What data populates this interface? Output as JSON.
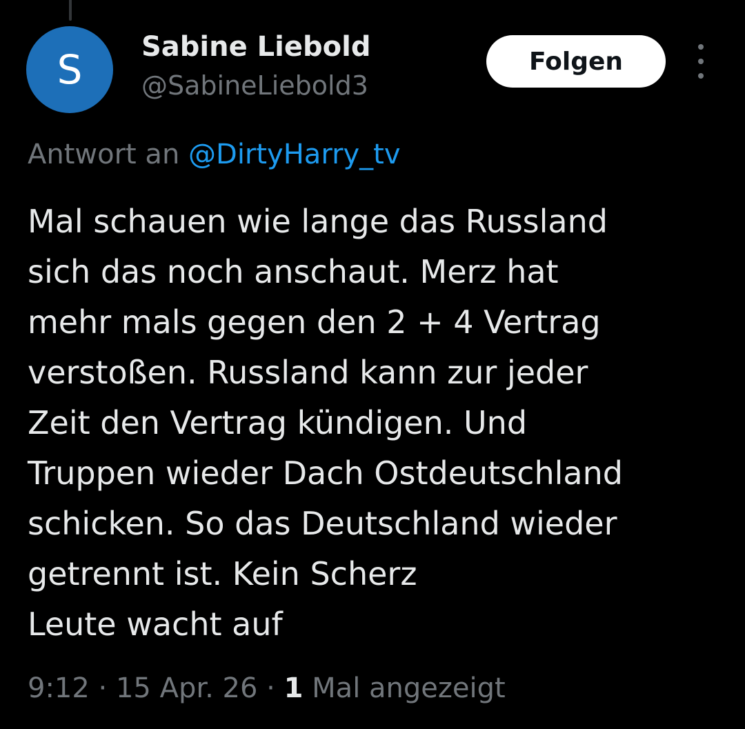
{
  "author": {
    "avatar_letter": "S",
    "avatar_color": "#1d6fb8",
    "display_name": "Sabine Liebold",
    "handle": "@SabineLiebold3"
  },
  "actions": {
    "follow_label": "Folgen",
    "more_icon": "more-vertical-icon"
  },
  "reply": {
    "prefix": "Antwort an",
    "mention": "@DirtyHarry_tv"
  },
  "tweet": {
    "lines": [
      "Mal schauen wie lange das Russland",
      "sich das noch anschaut. Merz hat",
      "mehr mals gegen den 2 + 4 Vertrag",
      "verstoßen. Russland kann zur jeder",
      "Zeit den Vertrag kündigen. Und",
      "Truppen wieder Dach Ostdeutschland",
      "schicken. So das Deutschland wieder",
      "getrennt ist. Kein Scherz",
      "Leute wacht auf"
    ]
  },
  "meta": {
    "time": "9:12",
    "separator": " · ",
    "date": "15 Apr. 26",
    "views_count": "1",
    "views_label": " Mal angezeigt"
  },
  "colors": {
    "background": "#000000",
    "text_primary": "#e7e9ea",
    "text_secondary": "#71767b",
    "accent": "#1d9bf0"
  }
}
